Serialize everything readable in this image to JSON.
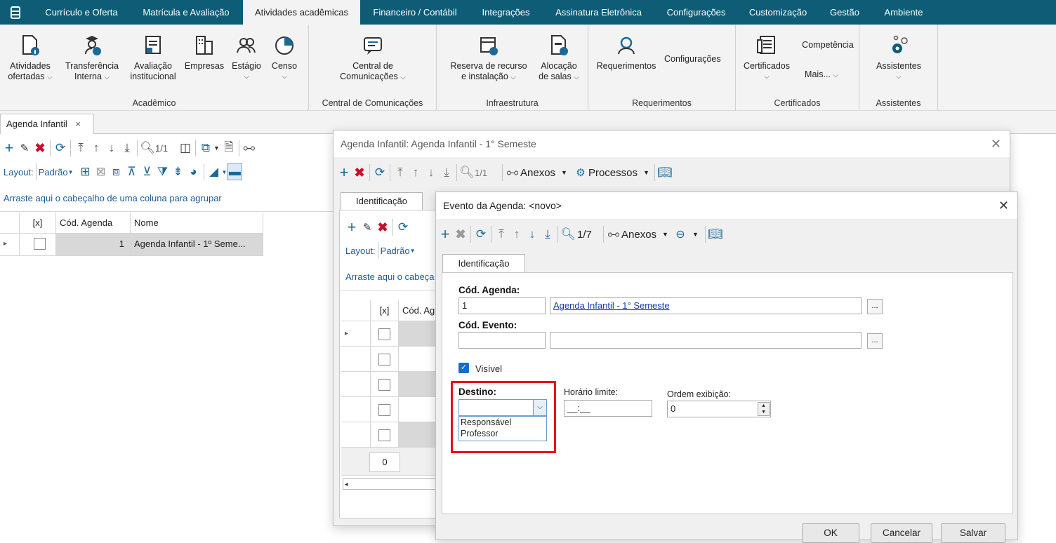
{
  "menubar": {
    "tabs": [
      "Currículo e Oferta",
      "Matrícula e Avaliação",
      "Atividades acadêmicas",
      "Financeiro / Contábil",
      "Integrações",
      "Assinatura Eletrônica",
      "Configurações",
      "Customização",
      "Gestão",
      "Ambiente"
    ],
    "active": "Atividades acadêmicas"
  },
  "ribbon": {
    "academico": {
      "title": "Acadêmico",
      "atividades": [
        "Atividades",
        "ofertadas"
      ],
      "transferencia": [
        "Transferência",
        "Interna"
      ],
      "avaliacao": [
        "Avaliação",
        "institucional"
      ],
      "empresas": "Empresas",
      "estagio": "Estágio",
      "censo": "Censo"
    },
    "comunicacoes": {
      "title": "Central de Comunicações",
      "central": [
        "Central de",
        "Comunicações"
      ]
    },
    "infra": {
      "title": "Infraestrutura",
      "reserva": [
        "Reserva de recurso",
        "e instalação"
      ],
      "alocacao": [
        "Alocação",
        "de salas"
      ]
    },
    "requerimentos": {
      "title": "Requerimentos",
      "req": "Requerimentos",
      "config": "Configurações"
    },
    "certificados": {
      "title": "Certificados",
      "cert": "Certificados",
      "competencia": "Competência",
      "mais": "Mais..."
    },
    "assistentes": {
      "title": "Assistentes",
      "assist": "Assistentes"
    }
  },
  "doctab": {
    "label": "Agenda Infantil",
    "close": "×"
  },
  "main": {
    "page_counter": "1/1",
    "layout_label": "Layout:",
    "layout_value": "Padrão",
    "group_hint": "Arraste aqui o cabeçalho de uma coluna para agrupar",
    "columns": [
      "[x]",
      "Cód. Agenda",
      "Nome"
    ],
    "rows": [
      {
        "cod": "1",
        "nome": "Agenda Infantil - 1º Seme..."
      }
    ]
  },
  "win1": {
    "title": "Agenda Infantil: Agenda Infantil - 1° Semeste",
    "page_counter": "1/1",
    "anexos": "Anexos",
    "processos": "Processos",
    "tab": "Identificação",
    "layout_label": "Layout:",
    "layout_value": "Padrão",
    "group_hint": "Arraste aqui o cabeça",
    "columns": [
      "[x]",
      "Cód. Ag"
    ],
    "footer_count": "0"
  },
  "win2": {
    "title": "Evento da Agenda: <novo>",
    "page_counter": "1/7",
    "anexos": "Anexos",
    "tab": "Identificação",
    "cod_agenda_label": "Cód. Agenda:",
    "cod_agenda_value": "1",
    "agenda_link": "Agenda Infantil - 1° Semeste",
    "cod_evento_label": "Cód. Evento:",
    "visivel_label": "Visível",
    "destino_label": "Destino:",
    "destino_options": [
      "Responsável",
      "Professor"
    ],
    "horario_label": "Horário limite:",
    "horario_value": "__:__",
    "ordem_label": "Ordem exibição:",
    "ordem_value": "0",
    "buttons": {
      "ok": "OK",
      "cancelar": "Cancelar",
      "salvar": "Salvar"
    },
    "ellipsis": "..."
  },
  "colors": {
    "menubar": "#0e5c75",
    "highlight": "#e8101a",
    "accent": "#1a6a99"
  }
}
